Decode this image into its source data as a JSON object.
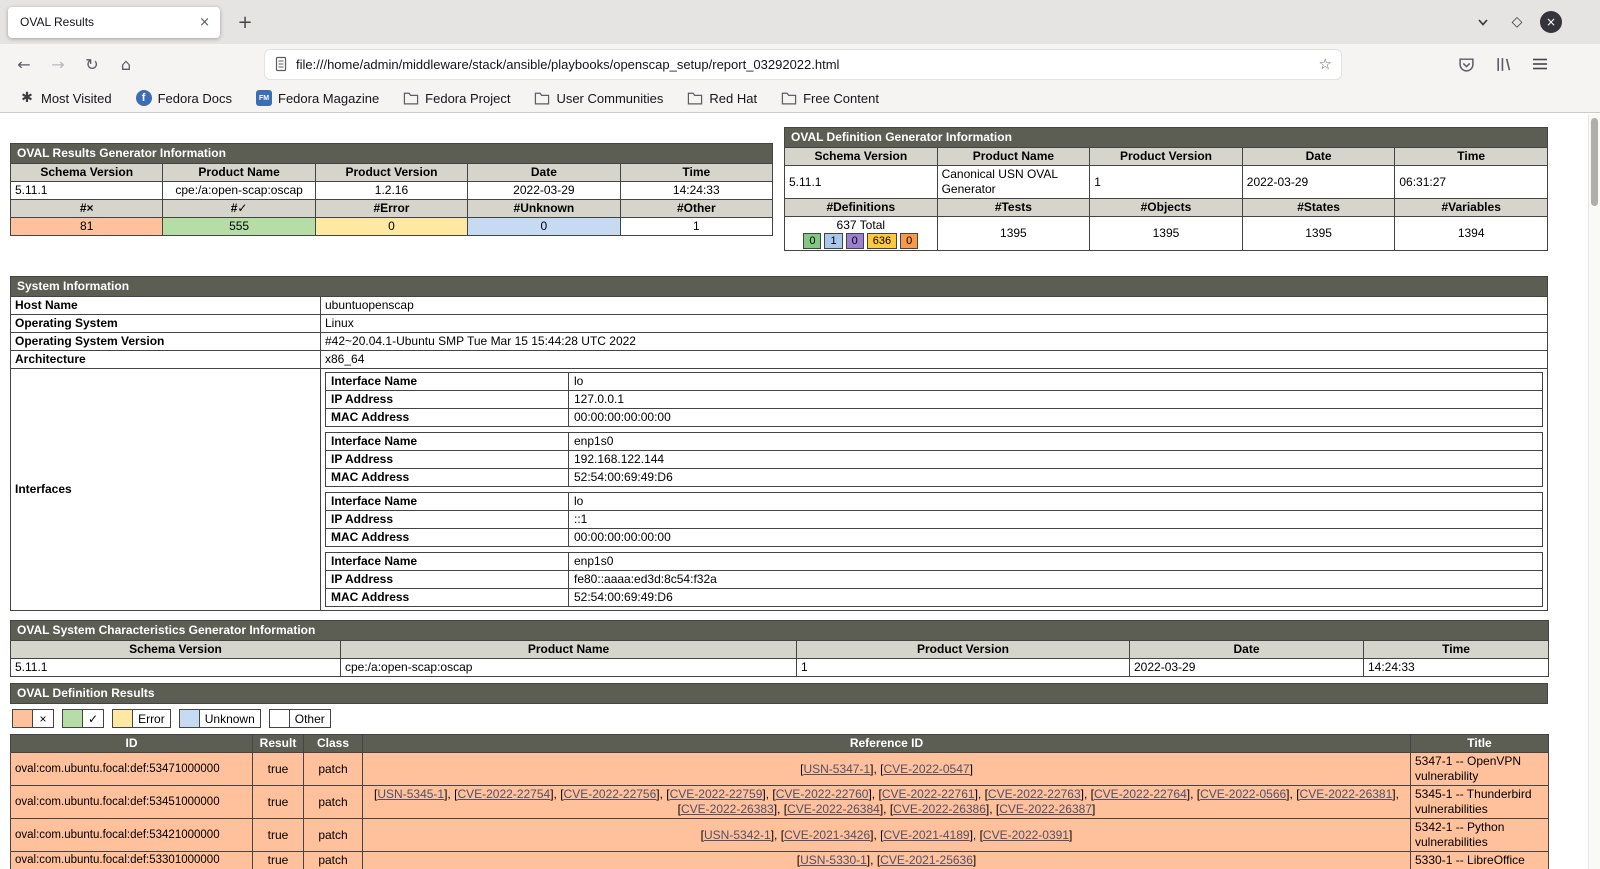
{
  "browser": {
    "tab_title": "OVAL Results",
    "url": "file:///home/admin/middleware/stack/ansible/playbooks/openscap_setup/report_03292022.html",
    "bookmarks": [
      {
        "label": "Most Visited",
        "icon": "gear"
      },
      {
        "label": "Fedora Docs",
        "icon": "fedora"
      },
      {
        "label": "Fedora Magazine",
        "icon": "fedora-magazine"
      },
      {
        "label": "Fedora Project",
        "icon": "folder"
      },
      {
        "label": "User Communities",
        "icon": "folder"
      },
      {
        "label": "Red Hat",
        "icon": "folder"
      },
      {
        "label": "Free Content",
        "icon": "folder"
      }
    ]
  },
  "colors": {
    "header_dark": "#5c5d53",
    "header_light": "#d5d5cb",
    "table_border": "#444444",
    "result_false": "#ffc09c",
    "result_true": "#b7dda6",
    "result_error": "#ffe8a2",
    "result_unknown": "#c6daf2",
    "result_other": "#ffffff",
    "link": "#515168",
    "fedora_blue": "#3c6eb4",
    "chrome_bg": "#e6e4e3",
    "toolbar_bg": "#f5f4f3",
    "accent_text": "#15141a"
  },
  "results_generator": {
    "title": "OVAL Results Generator Information",
    "columns": [
      "Schema Version",
      "Product Name",
      "Product Version",
      "Date",
      "Time"
    ],
    "row": [
      "5.11.1",
      "cpe:/a:open-scap:oscap",
      "1.2.16",
      "2022-03-29",
      "14:24:33"
    ],
    "count_columns": [
      "#×",
      "#✓",
      "#Error",
      "#Unknown",
      "#Other"
    ],
    "counts": [
      "81",
      "555",
      "0",
      "0",
      "1"
    ]
  },
  "definition_generator": {
    "title": "OVAL Definition Generator Information",
    "columns": [
      "Schema Version",
      "Product Name",
      "Product Version",
      "Date",
      "Time"
    ],
    "row": [
      "5.11.1",
      "Canonical USN OVAL Generator",
      "1",
      "2022-03-29",
      "06:31:27"
    ],
    "count_columns": [
      "#Definitions",
      "#Tests",
      "#Objects",
      "#States",
      "#Variables"
    ],
    "definitions_total": "637 Total",
    "breakdown": [
      {
        "count": "0",
        "color": "#82c882"
      },
      {
        "count": "1",
        "color": "#a9c9ea"
      },
      {
        "count": "0",
        "color": "#9b7fd0"
      },
      {
        "count": "636",
        "color": "#ffc83d"
      },
      {
        "count": "0",
        "color": "#f89a4a"
      }
    ],
    "counts": [
      "1395",
      "1395",
      "1395",
      "1394"
    ]
  },
  "system_info": {
    "title": "System Information",
    "rows": [
      {
        "label": "Host Name",
        "value": "ubuntuopenscap"
      },
      {
        "label": "Operating System",
        "value": "Linux"
      },
      {
        "label": "Operating System Version",
        "value": "#42~20.04.1-Ubuntu SMP Tue Mar 15 15:44:28 UTC 2022"
      },
      {
        "label": "Architecture",
        "value": "x86_64"
      }
    ],
    "interfaces_label": "Interfaces",
    "interface_field_labels": [
      "Interface Name",
      "IP Address",
      "MAC Address"
    ],
    "interfaces": [
      {
        "name": "lo",
        "ip": "127.0.0.1",
        "mac": "00:00:00:00:00:00"
      },
      {
        "name": "enp1s0",
        "ip": "192.168.122.144",
        "mac": "52:54:00:69:49:D6"
      },
      {
        "name": "lo",
        "ip": "::1",
        "mac": "00:00:00:00:00:00"
      },
      {
        "name": "enp1s0",
        "ip": "fe80::aaaa:ed3d:8c54:f32a",
        "mac": "52:54:00:69:49:D6"
      }
    ]
  },
  "sc_generator": {
    "title": "OVAL System Characteristics Generator Information",
    "columns": [
      "Schema Version",
      "Product Name",
      "Product Version",
      "Date",
      "Time"
    ],
    "row": [
      "5.11.1",
      "cpe:/a:open-scap:oscap",
      "1",
      "2022-03-29",
      "14:24:33"
    ]
  },
  "definition_results": {
    "title": "OVAL Definition Results",
    "legend": [
      {
        "label": "×",
        "color": "#ffc09c"
      },
      {
        "label": "✓",
        "color": "#b7dda6"
      },
      {
        "label": "Error",
        "color": "#ffe8a2"
      },
      {
        "label": "Unknown",
        "color": "#c6daf2"
      },
      {
        "label": "Other",
        "color": "#ffffff"
      }
    ],
    "columns": [
      "ID",
      "Result",
      "Class",
      "Reference ID",
      "Title"
    ],
    "rows": [
      {
        "id": "oval:com.ubuntu.focal:def:53471000000",
        "result": "true",
        "class": "patch",
        "references": [
          "USN-5347-1",
          "CVE-2022-0547"
        ],
        "title": "5347-1 -- OpenVPN vulnerability"
      },
      {
        "id": "oval:com.ubuntu.focal:def:53451000000",
        "result": "true",
        "class": "patch",
        "references": [
          "USN-5345-1",
          "CVE-2022-22754",
          "CVE-2022-22756",
          "CVE-2022-22759",
          "CVE-2022-22760",
          "CVE-2022-22761",
          "CVE-2022-22763",
          "CVE-2022-22764",
          "CVE-2022-0566",
          "CVE-2022-26381",
          "CVE-2022-26383",
          "CVE-2022-26384",
          "CVE-2022-26386",
          "CVE-2022-26387"
        ],
        "title": "5345-1 -- Thunderbird vulnerabilities"
      },
      {
        "id": "oval:com.ubuntu.focal:def:53421000000",
        "result": "true",
        "class": "patch",
        "references": [
          "USN-5342-1",
          "CVE-2021-3426",
          "CVE-2021-4189",
          "CVE-2022-0391"
        ],
        "title": "5342-1 -- Python vulnerabilities"
      },
      {
        "id": "oval:com.ubuntu.focal:def:53301000000",
        "result": "true",
        "class": "patch",
        "references": [
          "USN-5330-1",
          "CVE-2021-25636"
        ],
        "title": "5330-1 -- LibreOffice"
      }
    ]
  }
}
